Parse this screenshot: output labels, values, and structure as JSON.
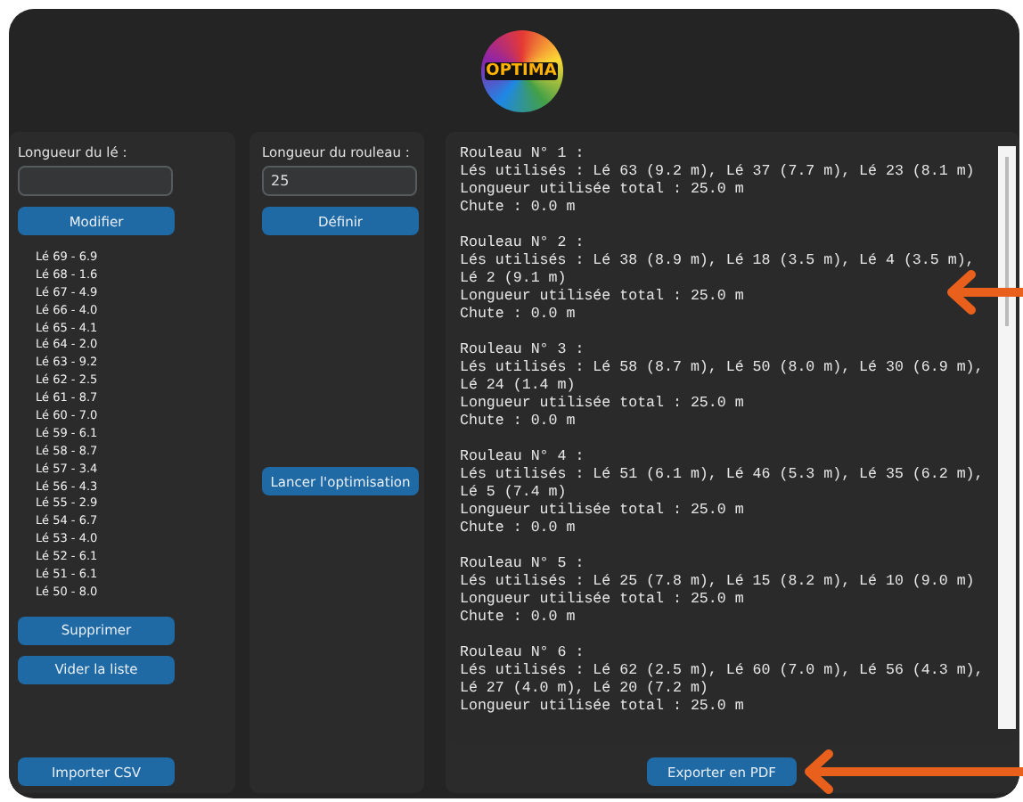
{
  "app": {
    "logo_text": "OPTIMA"
  },
  "left_panel": {
    "label": "Longueur du lé :",
    "buttons_top": [
      "Modifier"
    ],
    "list_items": [
      "Lé 69 - 6.9",
      "Lé 68 - 1.6",
      "Lé 67 - 4.9",
      "Lé 66 - 4.0",
      "Lé 65 - 4.1",
      "Lé 64 - 2.0",
      "Lé 63 - 9.2",
      "Lé 62 - 2.5",
      "Lé 61 - 8.7",
      "Lé 60 - 7.0",
      "Lé 59 - 6.1",
      "Lé 58 - 8.7",
      "Lé 57 - 3.4",
      "Lé 56 - 4.3",
      "Lé 55 - 2.9",
      "Lé 54 - 6.7",
      "Lé 53 - 4.0",
      "Lé 52 - 6.1",
      "Lé 51 - 6.1",
      "Lé 50 - 8.0"
    ],
    "buttons_bottom": [
      "Supprimer",
      "Vider la liste"
    ],
    "import_button": "Importer CSV"
  },
  "middle_panel": {
    "label": "Longueur du rouleau :",
    "input": {
      "value": "25"
    },
    "define_button": "Définir",
    "run_button": "Lancer l'optimisation"
  },
  "results": {
    "blocks": [
      {
        "lines": [
          "Rouleau N° 1 :",
          "Lés utilisés : Lé 63 (9.2 m), Lé 37 (7.7 m), Lé 23 (8.1 m)",
          "Longueur utilisée total : 25.0 m",
          "Chute : 0.0 m"
        ]
      },
      {
        "lines": [
          "Rouleau N° 2 :",
          "Lés utilisés : Lé 38 (8.9 m), Lé 18 (3.5 m), Lé 4 (3.5 m),",
          "Lé 2 (9.1 m)",
          "Longueur utilisée total : 25.0 m",
          "Chute : 0.0 m"
        ]
      },
      {
        "lines": [
          "Rouleau N° 3 :",
          "Lés utilisés : Lé 58 (8.7 m), Lé 50 (8.0 m), Lé 30 (6.9 m),",
          "Lé 24 (1.4 m)",
          "Longueur utilisée total : 25.0 m",
          "Chute : 0.0 m"
        ]
      },
      {
        "lines": [
          "Rouleau N° 4 :",
          "Lés utilisés : Lé 51 (6.1 m), Lé 46 (5.3 m), Lé 35 (6.2 m),",
          "Lé 5 (7.4 m)",
          "Longueur utilisée total : 25.0 m",
          "Chute : 0.0 m"
        ]
      },
      {
        "lines": [
          "Rouleau N° 5 :",
          "Lés utilisés : Lé 25 (7.8 m), Lé 15 (8.2 m), Lé 10 (9.0 m)",
          "Longueur utilisée total : 25.0 m",
          "Chute : 0.0 m"
        ]
      },
      {
        "lines": [
          "Rouleau N° 6 :",
          "Lés utilisés : Lé 62 (2.5 m), Lé 60 (7.0 m), Lé 56 (4.3 m),",
          "Lé 27 (4.0 m), Lé 20 (7.2 m)",
          "Longueur utilisée total : 25.0 m"
        ]
      }
    ],
    "export_button": "Exporter en PDF"
  }
}
